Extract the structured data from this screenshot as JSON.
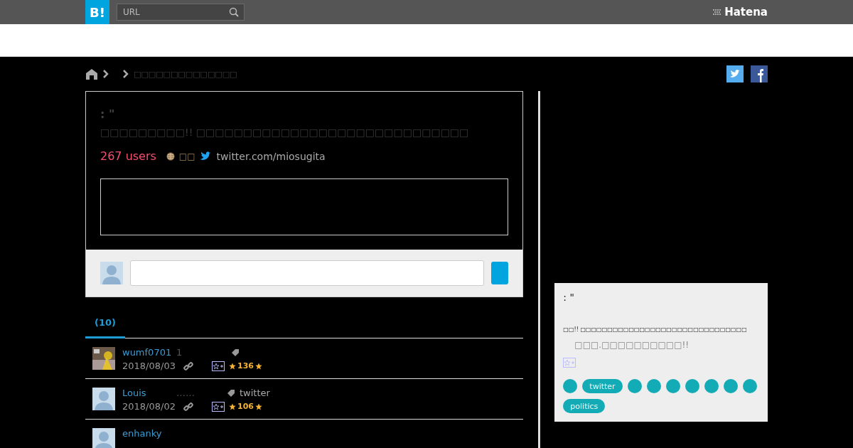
{
  "header": {
    "logo": "B!",
    "search": {
      "placeholder": "URL"
    },
    "brand": "Hatena"
  },
  "breadcrumb": {
    "current": "□□□□□□□□□□□□□□"
  },
  "entry": {
    "prefix": ": \"",
    "title": "□□□□□□□□□!! □□□□□□□□□□□□□□□□□□□□□□□□□□□□□",
    "users": "267 users",
    "category": "□□",
    "domain": "twitter.com/miosugita"
  },
  "tabs": [
    {
      "label": "(10)",
      "selected": true
    }
  ],
  "bookmarks": [
    {
      "user": "wumf0701",
      "comment": "1",
      "has_tag": true,
      "date": "2018/08/03",
      "stars": "136"
    },
    {
      "user": "Louis",
      "avatar": {
        "kind": "default"
      },
      "comment": "……",
      "has_tag": true,
      "tag": "twitter",
      "date": "2018/08/02",
      "stars": "106"
    },
    {
      "user": "enhanky",
      "avatar": {
        "kind": "default"
      }
    }
  ],
  "side": {
    "prefix": ": \"",
    "title": "□□!! □□□□□□□□□□□□□□□□□□□□□□□□□□□□□□□",
    "subtitle": "□□□.□□□□□□□□□□!!",
    "tags": [
      {
        "kind": "blank"
      },
      {
        "kind": "label",
        "label": "twitter"
      },
      {
        "kind": "blank"
      },
      {
        "kind": "blank"
      },
      {
        "kind": "blank"
      },
      {
        "kind": "blank"
      },
      {
        "kind": "blank"
      },
      {
        "kind": "blank"
      },
      {
        "kind": "blank"
      },
      {
        "kind": "label",
        "label": "politics"
      }
    ]
  }
}
